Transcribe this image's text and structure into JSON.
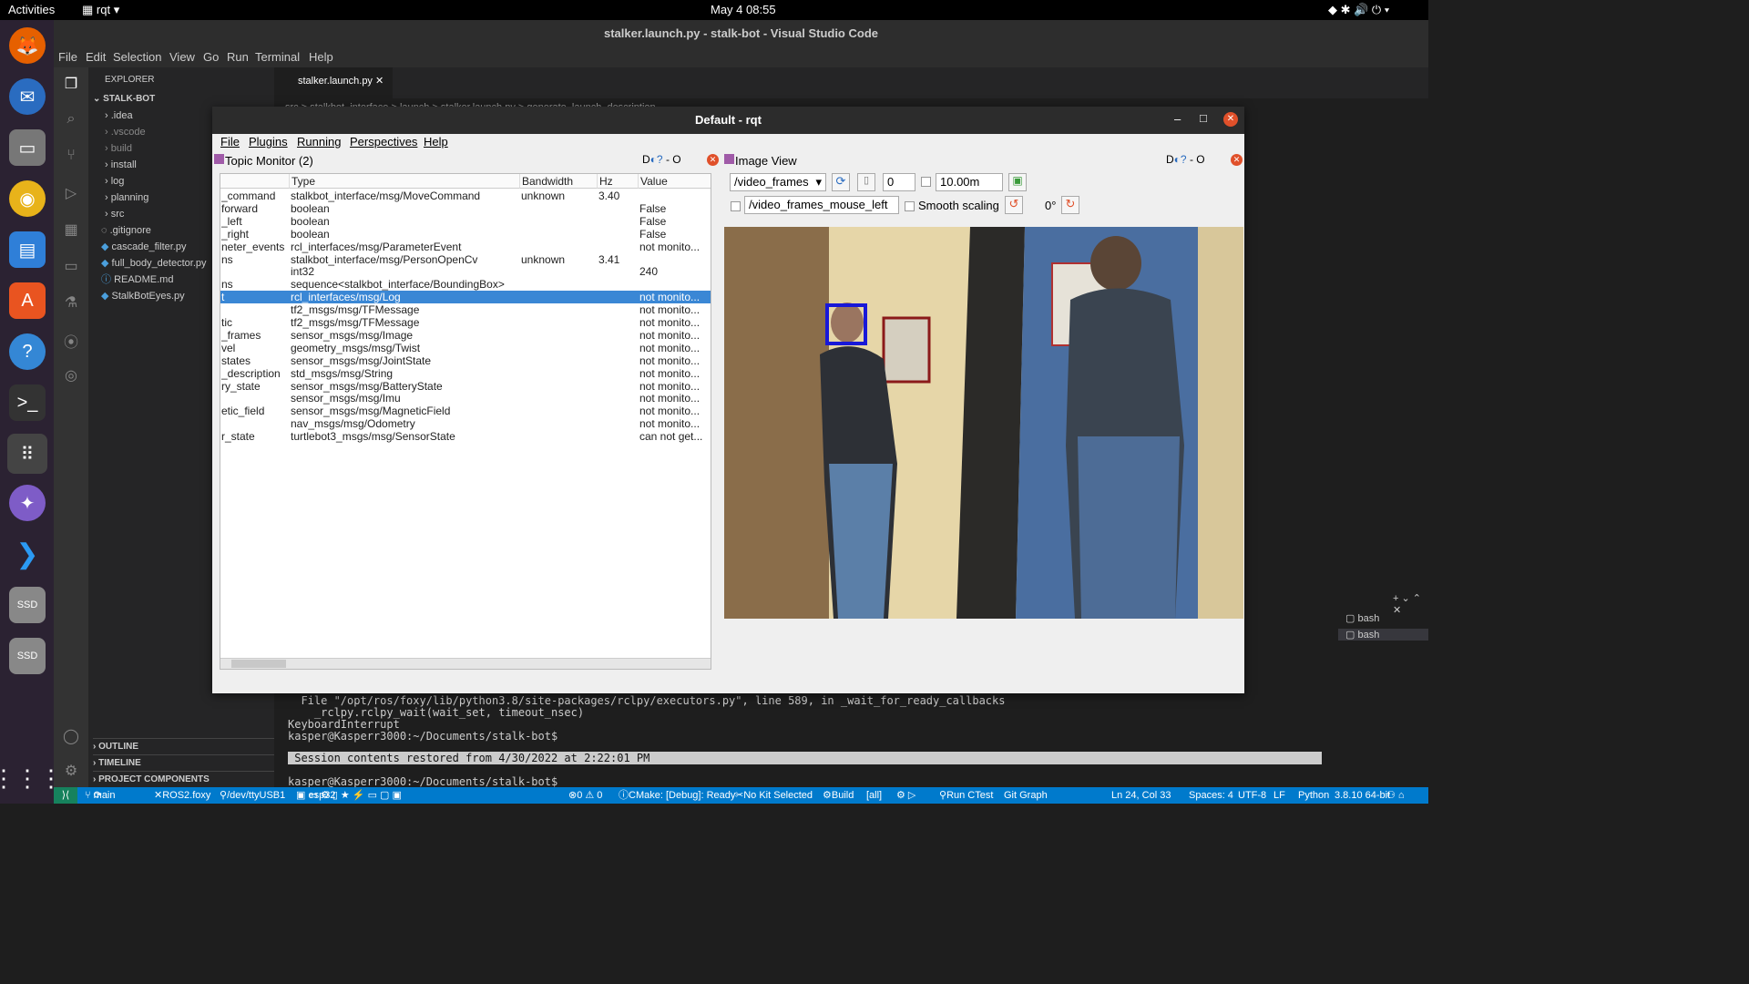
{
  "topbar": {
    "activities": "Activities",
    "app": "rqt",
    "clock": "May 4  08:55"
  },
  "vscode": {
    "title": "stalker.launch.py - stalk-bot - Visual Studio Code",
    "menu": [
      "File",
      "Edit",
      "Selection",
      "View",
      "Go",
      "Run",
      "Terminal",
      "Help"
    ],
    "explorer_title": "EXPLORER",
    "project": "STALK-BOT",
    "tree": [
      ".idea",
      ".vscode",
      "build",
      "install",
      "log",
      "planning",
      "src",
      ".gitignore",
      "cascade_filter.py",
      "full_body_detector.py",
      "README.md",
      "StalkBotEyes.py"
    ],
    "outline": "OUTLINE",
    "timeline": "TIMELINE",
    "project_components": "PROJECT COMPONENTS",
    "tab": "stalker.launch.py",
    "breadcrumb": "src > stalkbot_interface > launch > stalker.launch.py > generate_launch_description",
    "terminal": [
      "  File \"/opt/ros/foxy/lib/python3.8/site-packages/rclpy/executors.py\", line 589, in _wait_for_ready_callbacks",
      "    _rclpy.rclpy_wait(wait_set, timeout_nsec)",
      "KeyboardInterrupt",
      "kasper@Kasperr3000:~/Documents/stalk-bot$",
      " Session contents restored from 4/30/2022 at 2:22:01 PM",
      "kasper@Kasperr3000:~/Documents/stalk-bot$"
    ],
    "term_list": [
      "bash",
      "bash"
    ],
    "status": [
      "main",
      "ROS2.foxy",
      "/dev/ttyUSB1",
      "esp32",
      "0 ⚠ 0",
      "CMake: [Debug]: Ready",
      "No Kit Selected",
      "Build",
      "[all]",
      "Run CTest",
      "Git Graph",
      "Ln 24, Col 33",
      "Spaces: 4",
      "UTF-8",
      "LF",
      "Python",
      "3.8.10 64-bit"
    ]
  },
  "rqt": {
    "title": "Default - rqt",
    "menu": [
      "File",
      "Plugins",
      "Running",
      "Perspectives",
      "Help"
    ],
    "topic_monitor": {
      "title": "Topic Monitor (2)",
      "headers": [
        "Type",
        "Bandwidth",
        "Hz",
        "Value"
      ],
      "rows": [
        [
          "_command",
          "stalkbot_interface/msg/MoveCommand",
          "unknown",
          "3.40",
          ""
        ],
        [
          "forward",
          "boolean",
          "",
          "",
          "False"
        ],
        [
          "_left",
          "boolean",
          "",
          "",
          "False"
        ],
        [
          "_right",
          "boolean",
          "",
          "",
          "False"
        ],
        [
          "neter_events",
          "rcl_interfaces/msg/ParameterEvent",
          "",
          "",
          "not monito..."
        ],
        [
          "ns",
          "stalkbot_interface/msg/PersonOpenCv",
          "unknown",
          "3.41",
          ""
        ],
        [
          "",
          "int32",
          "",
          "",
          "240"
        ],
        [
          "ns",
          "sequence<stalkbot_interface/BoundingBox>",
          "",
          "",
          ""
        ],
        [
          "t",
          "rcl_interfaces/msg/Log",
          "",
          "",
          "not monito..."
        ],
        [
          "",
          "tf2_msgs/msg/TFMessage",
          "",
          "",
          "not monito..."
        ],
        [
          "tic",
          "tf2_msgs/msg/TFMessage",
          "",
          "",
          "not monito..."
        ],
        [
          "_frames",
          "sensor_msgs/msg/Image",
          "",
          "",
          "not monito..."
        ],
        [
          "vel",
          "geometry_msgs/msg/Twist",
          "",
          "",
          "not monito..."
        ],
        [
          "states",
          "sensor_msgs/msg/JointState",
          "",
          "",
          "not monito..."
        ],
        [
          "_description",
          "std_msgs/msg/String",
          "",
          "",
          "not monito..."
        ],
        [
          "ry_state",
          "sensor_msgs/msg/BatteryState",
          "",
          "",
          "not monito..."
        ],
        [
          "",
          "sensor_msgs/msg/Imu",
          "",
          "",
          "not monito..."
        ],
        [
          "etic_field",
          "sensor_msgs/msg/MagneticField",
          "",
          "",
          "not monito..."
        ],
        [
          "",
          "nav_msgs/msg/Odometry",
          "",
          "",
          "not monito..."
        ],
        [
          "r_state",
          "turtlebot3_msgs/msg/SensorState",
          "",
          "",
          "can not get..."
        ]
      ]
    },
    "image_view": {
      "title": "Image View",
      "topic": "/video_frames",
      "zero": "0",
      "max": "10.00m",
      "mouse_topic": "/video_frames_mouse_left",
      "smooth": "Smooth scaling",
      "rotation": "0°"
    }
  }
}
